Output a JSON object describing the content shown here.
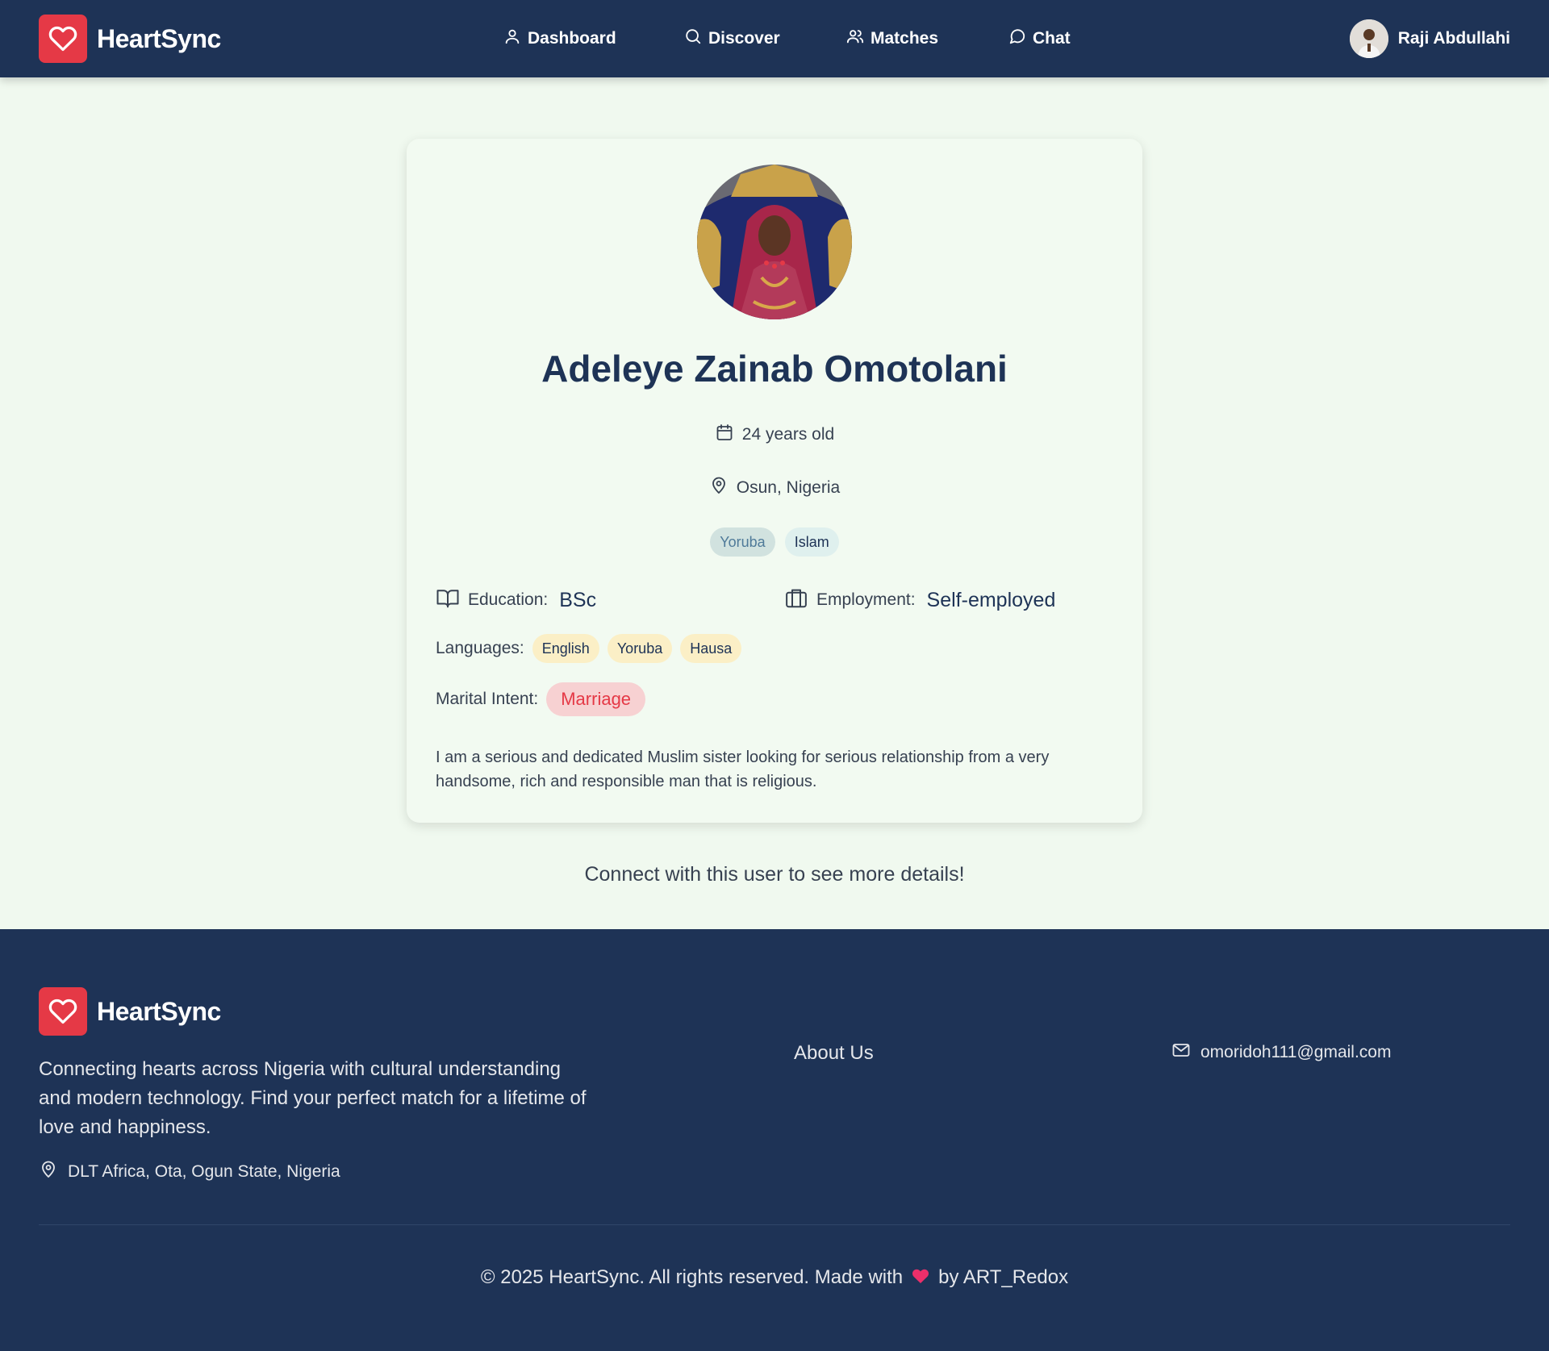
{
  "header": {
    "brand": "HeartSync",
    "nav": [
      {
        "label": "Dashboard",
        "icon": "user-icon"
      },
      {
        "label": "Discover",
        "icon": "search-icon"
      },
      {
        "label": "Matches",
        "icon": "users-icon"
      },
      {
        "label": "Chat",
        "icon": "message-circle-icon"
      }
    ],
    "user_name": "Raji Abdullahi"
  },
  "profile": {
    "name": "Adeleye Zainab Omotolani",
    "age": "24 years old",
    "location": "Osun, Nigeria",
    "tags": [
      "Yoruba",
      "Islam"
    ],
    "education_label": "Education:",
    "education_value": "BSc",
    "employment_label": "Employment:",
    "employment_value": "Self-employed",
    "languages_label": "Languages:",
    "languages": [
      "English",
      "Yoruba",
      "Hausa"
    ],
    "marital_label": "Marital Intent:",
    "marital_value": "Marriage",
    "bio": "I am a serious and dedicated Muslim sister looking for serious relationship from a very handsome, rich and responsible man that is religious."
  },
  "connect_message": "Connect with this user to see more details!",
  "footer": {
    "brand": "HeartSync",
    "description": "Connecting hearts across Nigeria with cultural understanding and modern technology. Find your perfect match for a lifetime of love and happiness.",
    "address": "DLT Africa, Ota, Ogun State, Nigeria",
    "about_link": "About Us",
    "email": "omoridoh111@gmail.com",
    "copyright_before": "© 2025 HeartSync. All rights reserved. Made with",
    "copyright_after": "by ART_Redox"
  },
  "colors": {
    "navy": "#1e3356",
    "accent_red": "#e53946",
    "page_bg": "#f0f9ef"
  }
}
